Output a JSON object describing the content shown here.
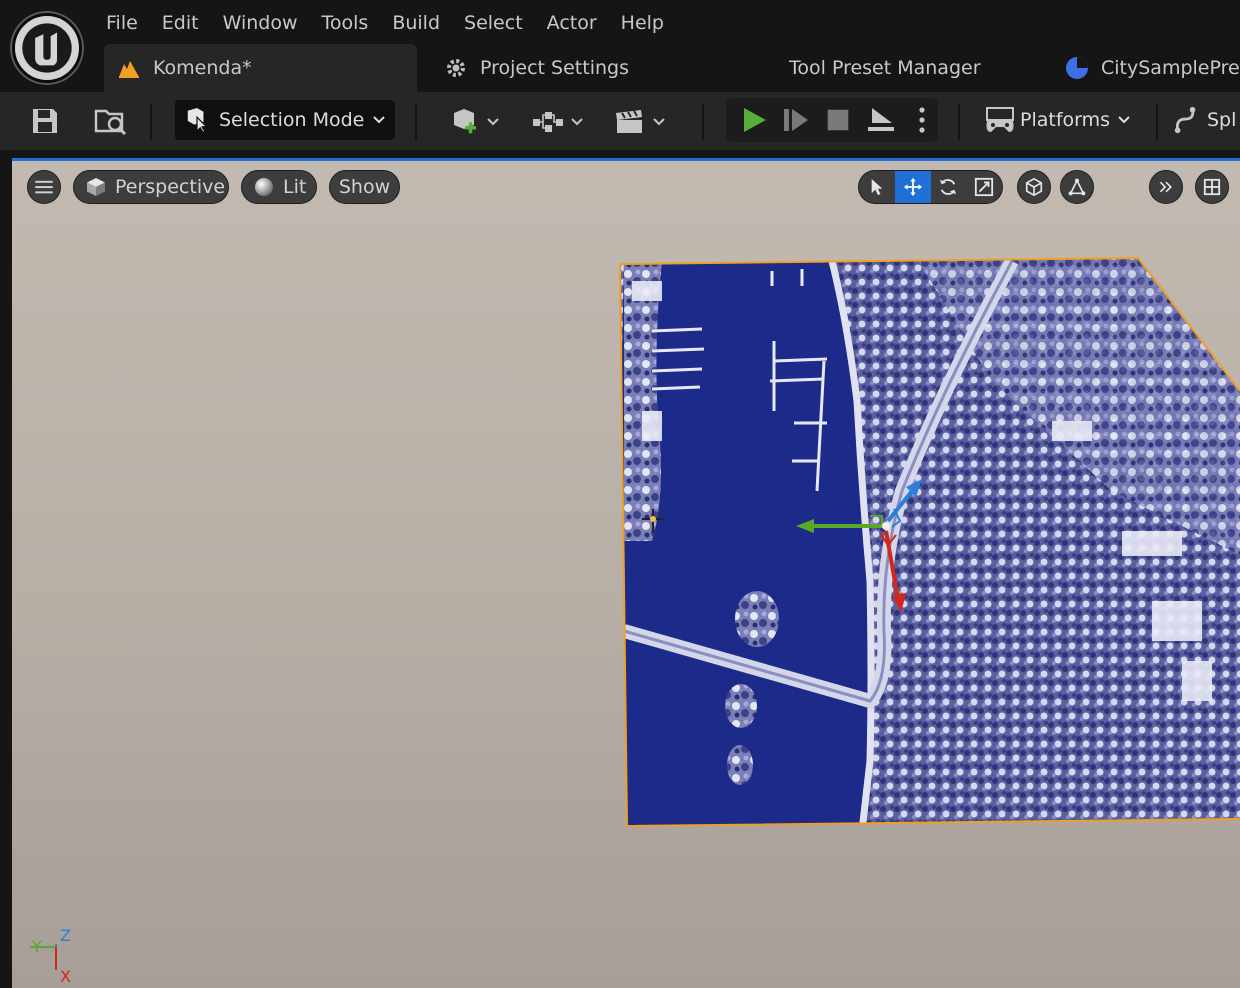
{
  "menu": [
    "File",
    "Edit",
    "Window",
    "Tools",
    "Build",
    "Select",
    "Actor",
    "Help"
  ],
  "tabs": [
    {
      "label": "Komenda*",
      "icon": "level-icon",
      "active": true
    },
    {
      "label": "Project Settings",
      "icon": "gear-icon",
      "active": false
    },
    {
      "label": "Tool Preset Manager",
      "icon": "",
      "active": false
    },
    {
      "label": "CitySamplePre",
      "icon": "blueprint-icon",
      "active": false
    }
  ],
  "toolbar": {
    "selection_mode": "Selection Mode",
    "platforms": "Platforms",
    "spline": "Spl"
  },
  "viewport": {
    "perspective": "Perspective",
    "lit": "Lit",
    "show": "Show"
  },
  "axis": {
    "z": "Z",
    "y": "Y",
    "x": "X"
  },
  "colors": {
    "accent": "#1f6fd6",
    "play": "#56b03a",
    "axis_x": "#d0281a",
    "axis_y": "#5aa82a",
    "axis_z": "#2d7fd8",
    "selection": "#f0a020"
  }
}
